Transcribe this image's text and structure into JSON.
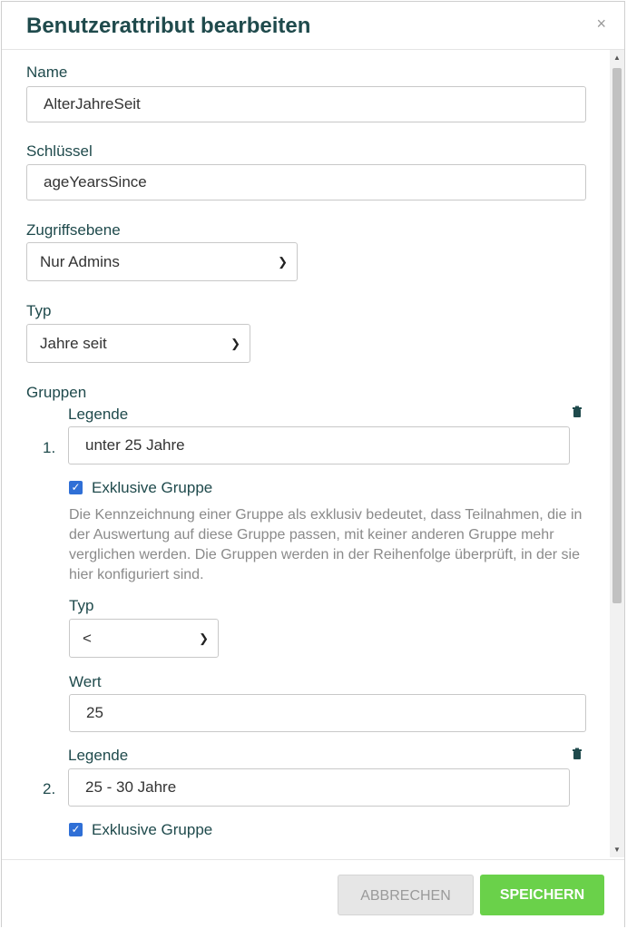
{
  "dialog": {
    "title": "Benutzerattribut bearbeiten",
    "close_glyph": "×"
  },
  "fields": {
    "name_label": "Name",
    "name_value": "AlterJahreSeit",
    "key_label": "Schlüssel",
    "key_value": "ageYearsSince",
    "access_label": "Zugriffsebene",
    "access_value": "Nur Admins",
    "type_label": "Typ",
    "type_value": "Jahre seit",
    "groups_label": "Gruppen"
  },
  "groups": [
    {
      "number": "1.",
      "legend_label": "Legende",
      "legend_value": "unter 25 Jahre",
      "exclusive_label": "Exklusive Gruppe",
      "help_text": "Die Kennzeichnung einer Gruppe als exklusiv bedeutet, dass Teilnahmen, die in der Auswertung auf diese Gruppe passen, mit keiner anderen Gruppe mehr verglichen werden. Die Gruppen werden in der Reihenfolge überprüft, in der sie hier konfiguriert sind.",
      "type_label": "Typ",
      "type_value": "<",
      "value_label": "Wert",
      "value": "25"
    },
    {
      "number": "2.",
      "legend_label": "Legende",
      "legend_value": "25 - 30 Jahre",
      "exclusive_label": "Exklusive Gruppe"
    }
  ],
  "footer": {
    "cancel_label": "ABBRECHEN",
    "save_label": "SPEICHERN"
  },
  "colors": {
    "title": "#1f4a4c",
    "checkbox": "#2f6fd6",
    "save": "#6ad14a"
  }
}
